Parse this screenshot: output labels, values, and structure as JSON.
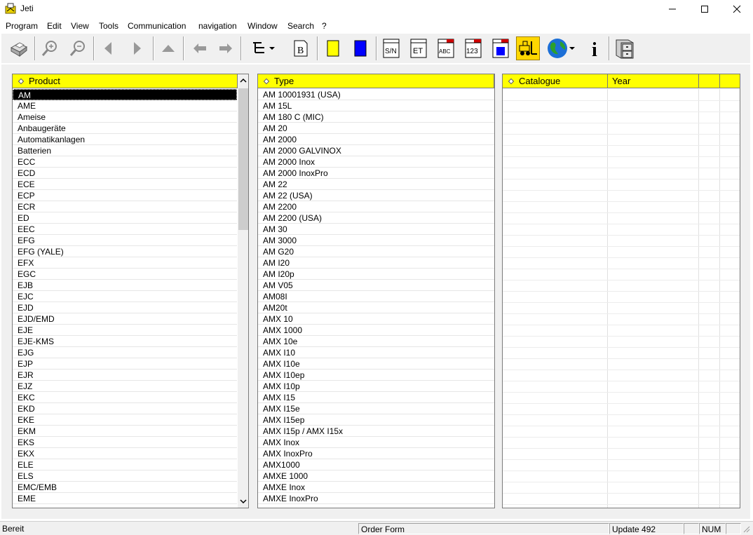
{
  "window": {
    "title": "Jeti"
  },
  "menu": [
    "Program",
    "Edit",
    "View",
    "Tools",
    "Communication",
    "navigation",
    "Window",
    "Search",
    "?"
  ],
  "toolbar": {
    "sn_label": "S/N",
    "et_label": "ET",
    "abc_label": "ABC",
    "num_label": "123",
    "b_label": "B",
    "info_label": "i"
  },
  "product": {
    "header": "Product",
    "items": [
      "AM",
      "AME",
      "Ameise",
      "Anbaugeräte",
      "Automatikanlagen",
      "Batterien",
      "ECC",
      "ECD",
      "ECE",
      "ECP",
      "ECR",
      "ED",
      "EEC",
      "EFG",
      "EFG (YALE)",
      "EFX",
      "EGC",
      "EJB",
      "EJC",
      "EJD",
      "EJD/EMD",
      "EJE",
      "EJE-KMS",
      "EJG",
      "EJP",
      "EJR",
      "EJZ",
      "EKC",
      "EKD",
      "EKE",
      "EKM",
      "EKS",
      "EKX",
      "ELE",
      "ELS",
      "EMC/EMB",
      "EME"
    ]
  },
  "type": {
    "header": "Type",
    "items": [
      "AM 10001931 (USA)",
      "AM 15L",
      "AM 180 C (MIC)",
      "AM 20",
      "AM 2000",
      "AM 2000 GALVINOX",
      "AM 2000 Inox",
      "AM 2000 InoxPro",
      "AM 22",
      "AM 22 (USA)",
      "AM 2200",
      "AM 2200 (USA)",
      "AM 30",
      "AM 3000",
      "AM G20",
      "AM I20",
      "AM I20p",
      "AM V05",
      "AM08I",
      "AM20t",
      "AMX 10",
      "AMX 1000",
      "AMX 10e",
      "AMX I10",
      "AMX I10e",
      "AMX I10ep",
      "AMX I10p",
      "AMX I15",
      "AMX I15e",
      "AMX I15ep",
      "AMX I15p / AMX I15x",
      "AMX Inox",
      "AMX InoxPro",
      "AMX1000",
      "AMXE 1000",
      "AMXE Inox",
      "AMXE InoxPro"
    ]
  },
  "catalogue": {
    "header_catalogue": "Catalogue",
    "header_year": "Year"
  },
  "status": {
    "ready": "Bereit",
    "order_form": "Order Form",
    "update": "Update 492",
    "num": "NUM"
  },
  "colors": {
    "header_yellow": "#ffff00",
    "selection": "#000000",
    "toolbar_blue": "#0000ff"
  }
}
